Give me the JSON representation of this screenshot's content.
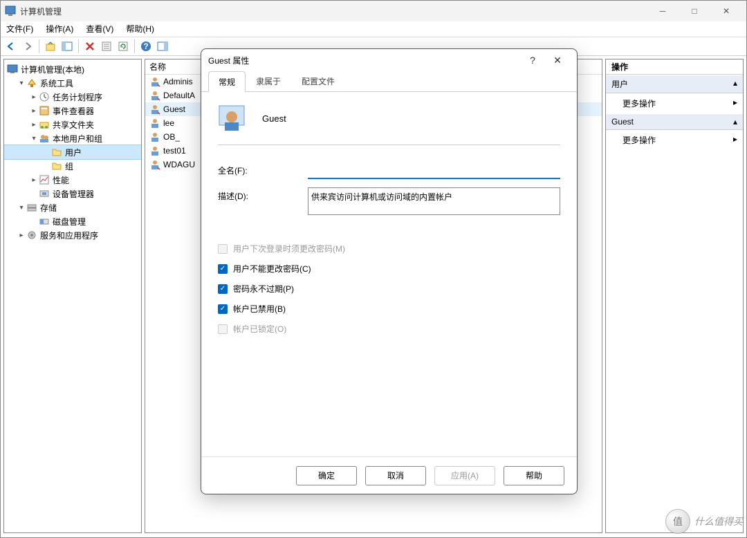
{
  "window": {
    "title": "计算机管理",
    "menus": [
      "文件(F)",
      "操作(A)",
      "查看(V)",
      "帮助(H)"
    ]
  },
  "tree": {
    "root": "计算机管理(本地)",
    "system_tools": "系统工具",
    "task_scheduler": "任务计划程序",
    "event_viewer": "事件查看器",
    "shared_folders": "共享文件夹",
    "local_users_groups": "本地用户和组",
    "users": "用户",
    "groups": "组",
    "performance": "性能",
    "device_manager": "设备管理器",
    "storage": "存储",
    "disk_management": "磁盘管理",
    "services_apps": "服务和应用程序"
  },
  "list": {
    "header": "名称",
    "items": [
      "Adminis",
      "DefaultA",
      "Guest",
      "lee",
      "OB_",
      "test01",
      "WDAGU"
    ]
  },
  "actions": {
    "header": "操作",
    "section1": "用户",
    "more1": "更多操作",
    "section2": "Guest",
    "more2": "更多操作"
  },
  "dialog": {
    "title": "Guest 属性",
    "tabs": [
      "常规",
      "隶属于",
      "配置文件"
    ],
    "username": "Guest",
    "fullname_label": "全名(F):",
    "fullname_value": "",
    "desc_label": "描述(D):",
    "desc_value": "供来宾访问计算机或访问域的内置帐户",
    "chk_must_change": "用户下次登录时须更改密码(M)",
    "chk_cannot_change": "用户不能更改密码(C)",
    "chk_never_expire": "密码永不过期(P)",
    "chk_disabled": "帐户已禁用(B)",
    "chk_locked": "帐户已锁定(O)",
    "btn_ok": "确定",
    "btn_cancel": "取消",
    "btn_apply": "应用(A)",
    "btn_help": "帮助"
  },
  "watermark": {
    "icon_text": "值",
    "text": "什么值得买"
  }
}
